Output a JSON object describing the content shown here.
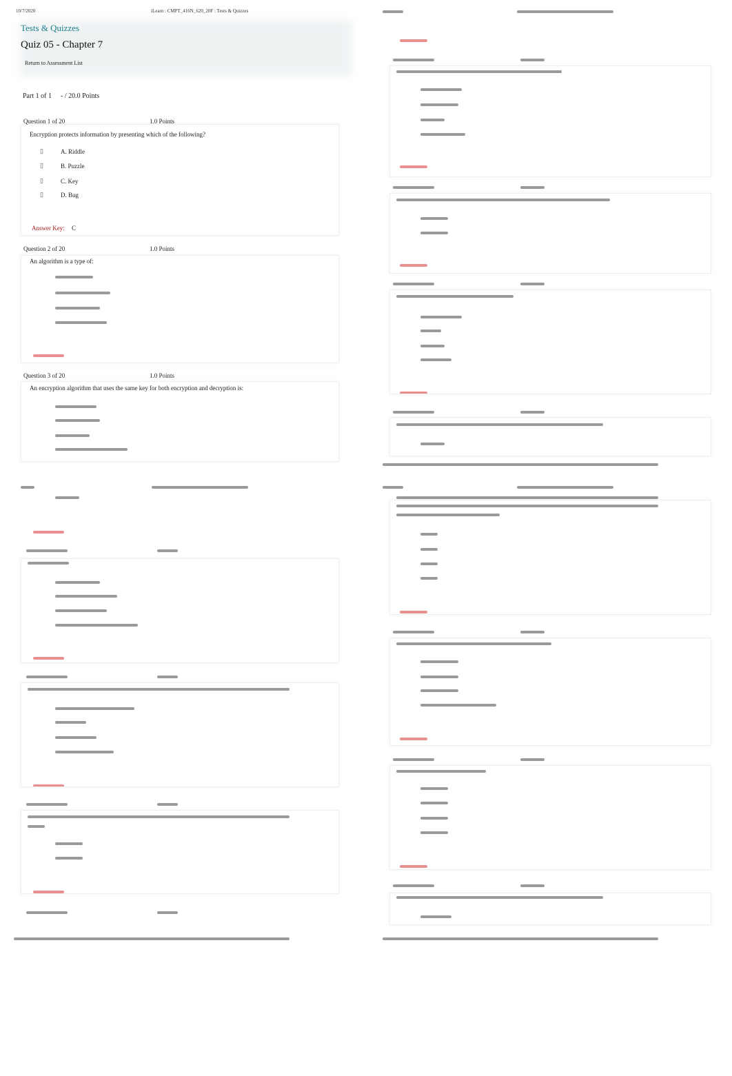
{
  "print_header": {
    "date": "10/7/2020",
    "page_title": "iLearn : CMPT_416N_620_20F : Tests & Quizzes"
  },
  "breadcrumb": "Tests & Quizzes",
  "quiz_title": "Quiz 05 - Chapter 7",
  "return_link": "Return to Assessment List",
  "part": {
    "label": "Part 1 of 1",
    "points": "- / 20.0 Points"
  },
  "questions": [
    {
      "number": "Question 1 of 20",
      "points": "1.0 Points",
      "text": "Encryption protects information by presenting which of the following?",
      "options": [
        "A. Riddle",
        "B. Puzzle",
        "C. Key",
        "D. Bug"
      ],
      "answer_key_label": "Answer Key:",
      "answer": "C"
    },
    {
      "number": "Question 2 of 20",
      "points": "1.0 Points",
      "text": "An algorithm is a type of:"
    },
    {
      "number": "Question 3 of 20",
      "points": "1.0 Points",
      "text": "An encryption algorithm that uses the same key for both encryption and decryption is:"
    }
  ],
  "radio_glyph": "▯",
  "colors": {
    "breadcrumb": "#1a7f8a",
    "answer_key": "#a11a1a"
  }
}
